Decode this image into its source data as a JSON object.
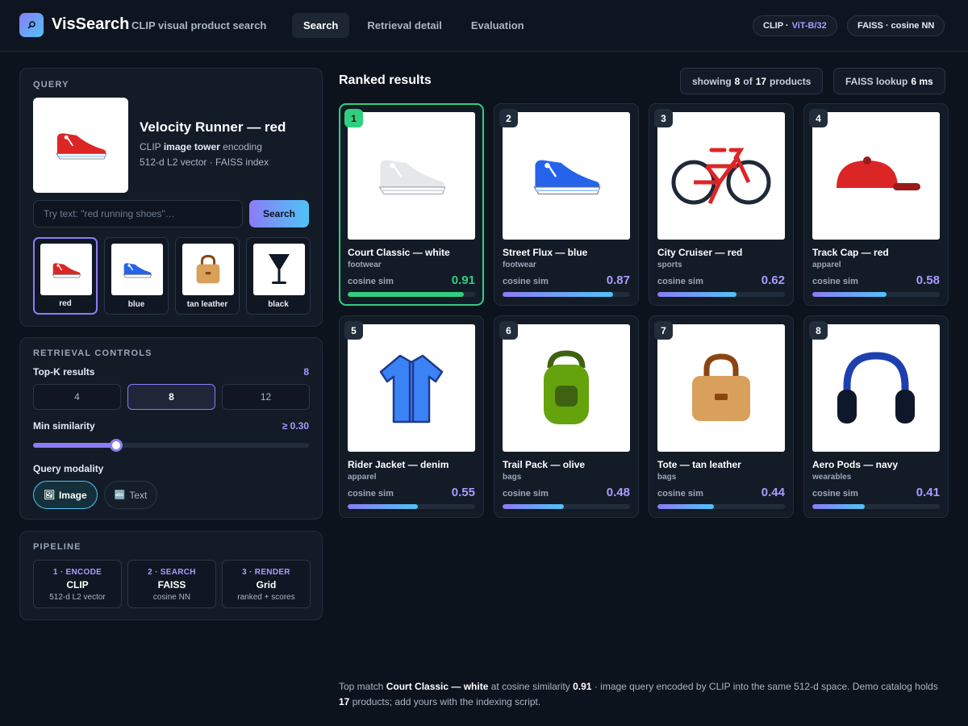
{
  "header": {
    "brand": "VisSearch",
    "subtitle": "CLIP visual product search",
    "nav": [
      {
        "label": "Search",
        "active": true
      },
      {
        "label": "Retrieval detail",
        "active": false
      },
      {
        "label": "Evaluation",
        "active": false
      }
    ],
    "model_pill": {
      "prefix": "CLIP ·",
      "value": "ViT-B/32"
    },
    "index_pill": "FAISS · cosine NN"
  },
  "query": {
    "section_title": "QUERY",
    "product_name": "Velocity Runner — red",
    "encoding_prefix": "CLIP",
    "encoding_bold": "image tower",
    "encoding_suffix": "encoding",
    "vector_info": "512-d L2 vector · FAISS index",
    "text_placeholder": "Try text: \"red running shoes\"…",
    "search_label": "Search",
    "swatches": [
      {
        "label": "red",
        "icon": "shoe-icon",
        "color": "#dc2626",
        "active": true
      },
      {
        "label": "blue",
        "icon": "shoe-icon",
        "color": "#2563eb",
        "active": false
      },
      {
        "label": "tan leather",
        "icon": "bag-icon",
        "color": "#d9a05b",
        "active": false
      },
      {
        "label": "black",
        "icon": "glass-icon",
        "color": "#111827",
        "active": false
      }
    ]
  },
  "controls": {
    "section_title": "RETRIEVAL CONTROLS",
    "topk_label": "Top-K results",
    "topk_value": "8",
    "topk_options": [
      "4",
      "8",
      "12"
    ],
    "minsim_label": "Min similarity",
    "minsim_value": "≥ 0.30",
    "minsim_fraction": 0.3,
    "modality_label": "Query modality",
    "modality_options": [
      {
        "label": "Image",
        "icon": "image-icon",
        "glyph": "🖼",
        "active": true
      },
      {
        "label": "Text",
        "icon": "text-icon",
        "glyph": "🔤",
        "active": false
      }
    ]
  },
  "pipeline": {
    "section_title": "PIPELINE",
    "steps": [
      {
        "step": "1 · ENCODE",
        "name": "CLIP",
        "desc": "512-d L2 vector"
      },
      {
        "step": "2 · SEARCH",
        "name": "FAISS",
        "desc": "cosine NN"
      },
      {
        "step": "3 · RENDER",
        "name": "Grid",
        "desc": "ranked + scores"
      }
    ]
  },
  "results": {
    "title": "Ranked results",
    "showing_prefix": "showing",
    "showing_count": "8",
    "showing_of": "of",
    "showing_total": "17",
    "showing_suffix": "products",
    "lookup_label": "FAISS lookup",
    "lookup_value": "6 ms",
    "score_label": "cosine sim",
    "items": [
      {
        "rank": "1",
        "name": "Court Classic — white",
        "category": "footwear",
        "score": "0.91",
        "score_value": 0.91,
        "icon": "shoe-icon",
        "color": "#e5e7eb"
      },
      {
        "rank": "2",
        "name": "Street Flux — blue",
        "category": "footwear",
        "score": "0.87",
        "score_value": 0.87,
        "icon": "shoe-icon",
        "color": "#2563eb"
      },
      {
        "rank": "3",
        "name": "City Cruiser — red",
        "category": "sports",
        "score": "0.62",
        "score_value": 0.62,
        "icon": "bicycle-icon",
        "color": "#dc2626"
      },
      {
        "rank": "4",
        "name": "Track Cap — red",
        "category": "apparel",
        "score": "0.58",
        "score_value": 0.58,
        "icon": "cap-icon",
        "color": "#dc2626"
      },
      {
        "rank": "5",
        "name": "Rider Jacket — denim",
        "category": "apparel",
        "score": "0.55",
        "score_value": 0.55,
        "icon": "jacket-icon",
        "color": "#3b82f6"
      },
      {
        "rank": "6",
        "name": "Trail Pack — olive",
        "category": "bags",
        "score": "0.48",
        "score_value": 0.48,
        "icon": "backpack-icon",
        "color": "#65a30d"
      },
      {
        "rank": "7",
        "name": "Tote — tan leather",
        "category": "bags",
        "score": "0.44",
        "score_value": 0.44,
        "icon": "bag-icon",
        "color": "#d9a05b"
      },
      {
        "rank": "8",
        "name": "Aero Pods — navy",
        "category": "wearables",
        "score": "0.41",
        "score_value": 0.41,
        "icon": "headphones-icon",
        "color": "#1e3a8a"
      }
    ]
  },
  "footer": {
    "t1": "Top match",
    "b1": "Court Classic — white",
    "t2": "at cosine similarity",
    "b2": "0.91",
    "t3": "· image query encoded by CLIP into the same 512-d space. Demo catalog holds",
    "b3": "17",
    "t4": "products; add yours with the indexing script."
  },
  "colors": {
    "accent": "#8b7cf6",
    "accent_cyan": "#4fc3f7",
    "top_match": "#2fcf7e",
    "background": "#0d131d"
  }
}
